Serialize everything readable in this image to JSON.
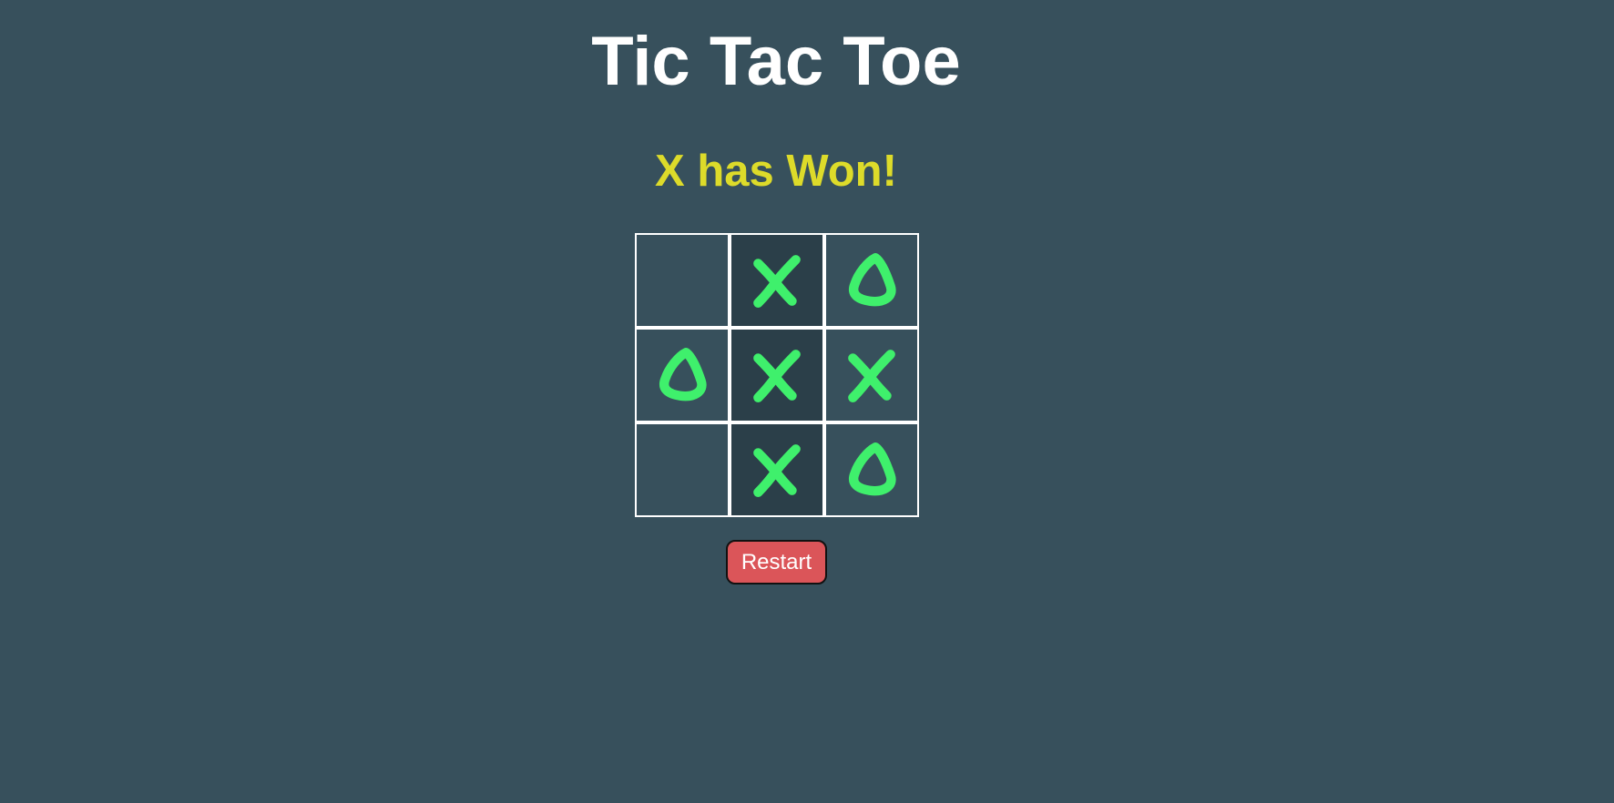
{
  "header": {
    "title": "Tic Tac Toe"
  },
  "game": {
    "status_message": "X has Won!",
    "winner": "X",
    "board": [
      "",
      "X",
      "O",
      "O",
      "X",
      "X",
      "",
      "X",
      "O"
    ],
    "winning_cells": [
      1,
      4,
      7
    ]
  },
  "controls": {
    "restart_label": "Restart"
  },
  "colors": {
    "background": "#37505c",
    "title": "#ffffff",
    "status": "#dddb2a",
    "mark": "#3ff06c",
    "winning_cell": "#2b3f49",
    "grid_line": "#ffffff",
    "restart_button": "#db5559"
  },
  "icons": {
    "X": "x-mark-icon",
    "O": "o-mark-icon"
  }
}
